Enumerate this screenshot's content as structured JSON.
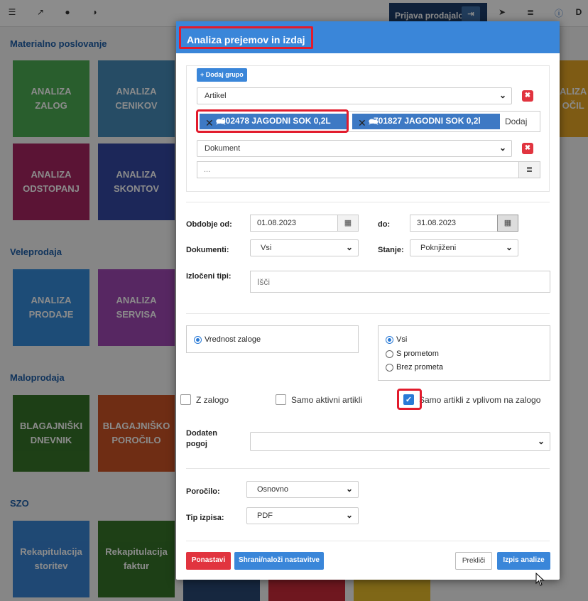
{
  "topbar": {
    "user_label": "Prijava prodajalca",
    "edge_label": "D",
    "icons": [
      "menu-icon",
      "external-link-icon",
      "user-lock-icon",
      "contrast-icon"
    ],
    "right_icons": [
      "send-icon",
      "list-icon",
      "info-icon"
    ]
  },
  "sections": [
    {
      "title": "Materialno poslovanje"
    },
    {
      "title": "Veleprodaja"
    },
    {
      "title": "Maloprodaja"
    },
    {
      "title": "SZO"
    }
  ],
  "tiles": {
    "analiza_zalog": "ANALIZA\nZALOG",
    "analiza_cenikov": "ANALIZA\nCENIKOV",
    "analiza_odstopanj": "ANALIZA\nODSTOPANJ",
    "analiza_skontov": "ANALIZA\nSKONTOV",
    "analiza_prodaje": "ANALIZA\nPRODAJE",
    "analiza_servisa": "ANALIZA\nSERVISA",
    "blagajniski_dnevnik": "BLAGAJNIŠKI\nDNEVNIK",
    "blagajnisko_porocilo": "BLAGAJNIŠKO\nPOROČILO",
    "rek_storitev": "Rekapitulacija\nstoritev",
    "rek_faktur": "Rekapitulacija\nfaktur",
    "right_partial": "ALIZA\nOČIL"
  },
  "modal": {
    "title": "Analiza prejemov in izdaj",
    "add_group_label": "+ Dodaj grupo",
    "group1_select": "Artikel",
    "tags": [
      {
        "label": "002478 JAGODNI SOK 0,2L"
      },
      {
        "label": "701827 JAGODNI SOK 0,2l"
      }
    ],
    "tag_input_placeholder": "Dodaj",
    "group2_select": "Dokument",
    "group2_input_placeholder": "...",
    "period_from_label": "Obdobje od:",
    "period_from": "01.08.2023",
    "period_to_label": "do:",
    "period_to": "31.08.2023",
    "documents_label": "Dokumenti:",
    "documents_value": "Vsi",
    "state_label": "Stanje:",
    "state_value": "Poknjiženi",
    "excluded_label": "Izločeni tipi:",
    "excluded_placeholder": "Išči",
    "radio_left": {
      "label": "Vrednost zaloge",
      "selected": true
    },
    "radio_right": [
      {
        "label": "Vsi",
        "selected": true
      },
      {
        "label": "S prometom",
        "selected": false
      },
      {
        "label": "Brez prometa",
        "selected": false
      }
    ],
    "checkboxes": [
      {
        "label": "Z zalogo",
        "checked": false
      },
      {
        "label": "Samo aktivni artikli",
        "checked": false
      },
      {
        "label": "Samo artikli z vplivom na zalogo",
        "checked": true
      }
    ],
    "extra_condition_label": "Dodaten pogoj",
    "extra_condition_value": "",
    "report_label": "Poročilo:",
    "report_value": "Osnovno",
    "print_type_label": "Tip izpisa:",
    "print_type_value": "PDF",
    "reset_button": "Ponastavi",
    "save_button": "Shrani/naloži nastavitve",
    "cancel_button": "Prekliči",
    "print_button": "Izpis analize"
  },
  "colors": {
    "accent": "#3a86d9",
    "danger": "#e1343f",
    "highlight": "#e21b2c"
  }
}
